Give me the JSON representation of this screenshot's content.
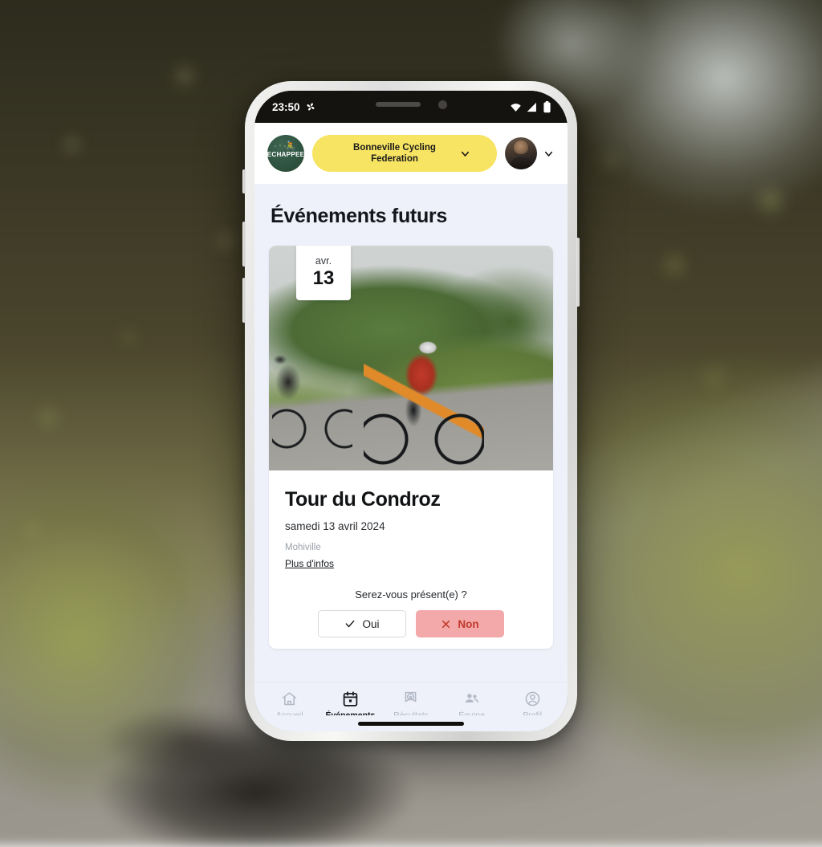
{
  "status_bar": {
    "time": "23:50",
    "left_icon": "pinwheel-icon",
    "wifi_icon": "wifi-icon",
    "signal_icon": "cellular-signal-icon",
    "battery_icon": "battery-icon"
  },
  "header": {
    "logo_word": "ECHAPPEE",
    "org_name": "Bonneville Cycling Federation",
    "org_chevron": "chevron-down-icon",
    "account_chevron": "chevron-down-icon",
    "accent_yellow": "#F7E463",
    "logo_green": "#2F5441"
  },
  "page": {
    "title": "Événements futurs"
  },
  "event": {
    "badge_month": "avr.",
    "badge_day": "13",
    "title": "Tour du Condroz",
    "date": "samedi 13 avril 2024",
    "place": "Mohiville",
    "more_info": "Plus d'infos",
    "rsvp_question": "Serez-vous présent(e) ?",
    "rsvp_yes": "Oui",
    "rsvp_no": "Non",
    "rsvp_yes_icon": "check-icon",
    "rsvp_no_icon": "close-icon",
    "rsvp_no_color": "#F3A9A9"
  },
  "bottom_nav": {
    "items": [
      {
        "label": "Accueil",
        "icon": "home-icon",
        "active": false
      },
      {
        "label": "Événements",
        "icon": "calendar-icon",
        "active": true
      },
      {
        "label": "Résultats",
        "icon": "medal-icon",
        "active": false
      },
      {
        "label": "Équipe",
        "icon": "people-icon",
        "active": false
      },
      {
        "label": "Profil",
        "icon": "person-circle-icon",
        "active": false
      }
    ]
  }
}
